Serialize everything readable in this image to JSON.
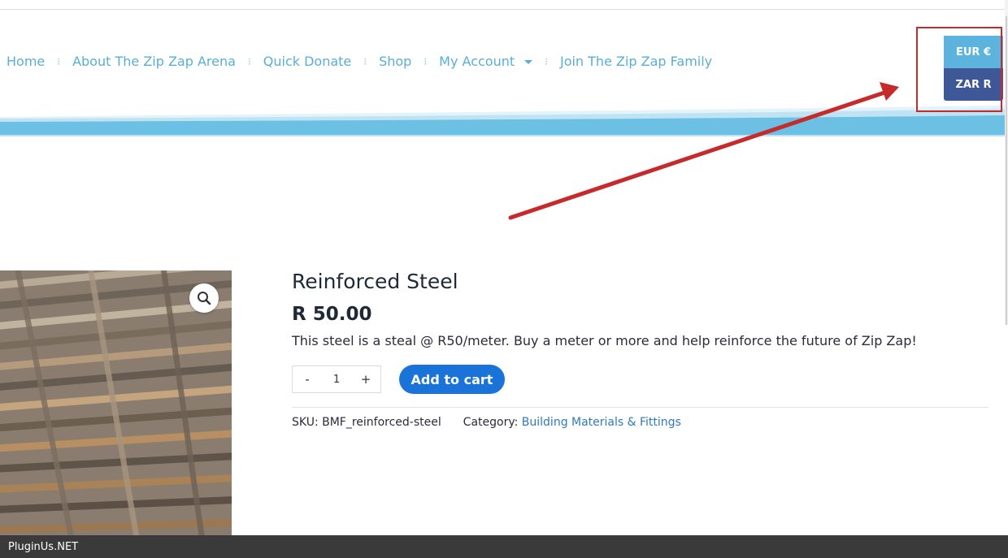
{
  "nav": {
    "items": [
      {
        "label": "Home"
      },
      {
        "label": "About The Zip Zap Arena"
      },
      {
        "label": "Quick Donate"
      },
      {
        "label": "Shop"
      },
      {
        "label": "My Account"
      },
      {
        "label": "Join The Zip Zap Family"
      }
    ],
    "separator": "⁝"
  },
  "currency": {
    "options": [
      "EUR €",
      "ZAR R"
    ],
    "active_color": "#3e5796",
    "inactive_color": "#5bb3de"
  },
  "annotation": {
    "arrow_color": "#c62a2a"
  },
  "product": {
    "title": "Reinforced Steel",
    "price": "R 50.00",
    "description": "This steel is a steal @ R50/meter. Buy a meter or more and help reinforce the future of Zip Zap!",
    "quantity": {
      "minus": "-",
      "value": "1",
      "plus": "+"
    },
    "add_to_cart_label": "Add to cart",
    "sku_label": "SKU:",
    "sku_value": "BMF_reinforced-steel",
    "category_label": "Category:",
    "category_value": "Building Materials & Fittings",
    "zoom_icon": "magnifier-icon"
  },
  "footer": {
    "text": "PluginUs.NET"
  },
  "colors": {
    "nav_link": "#5aaed6",
    "brand_blue": "#1a73d9",
    "wave_light": "#bfe3f3",
    "wave_main": "#6cc0e4"
  }
}
